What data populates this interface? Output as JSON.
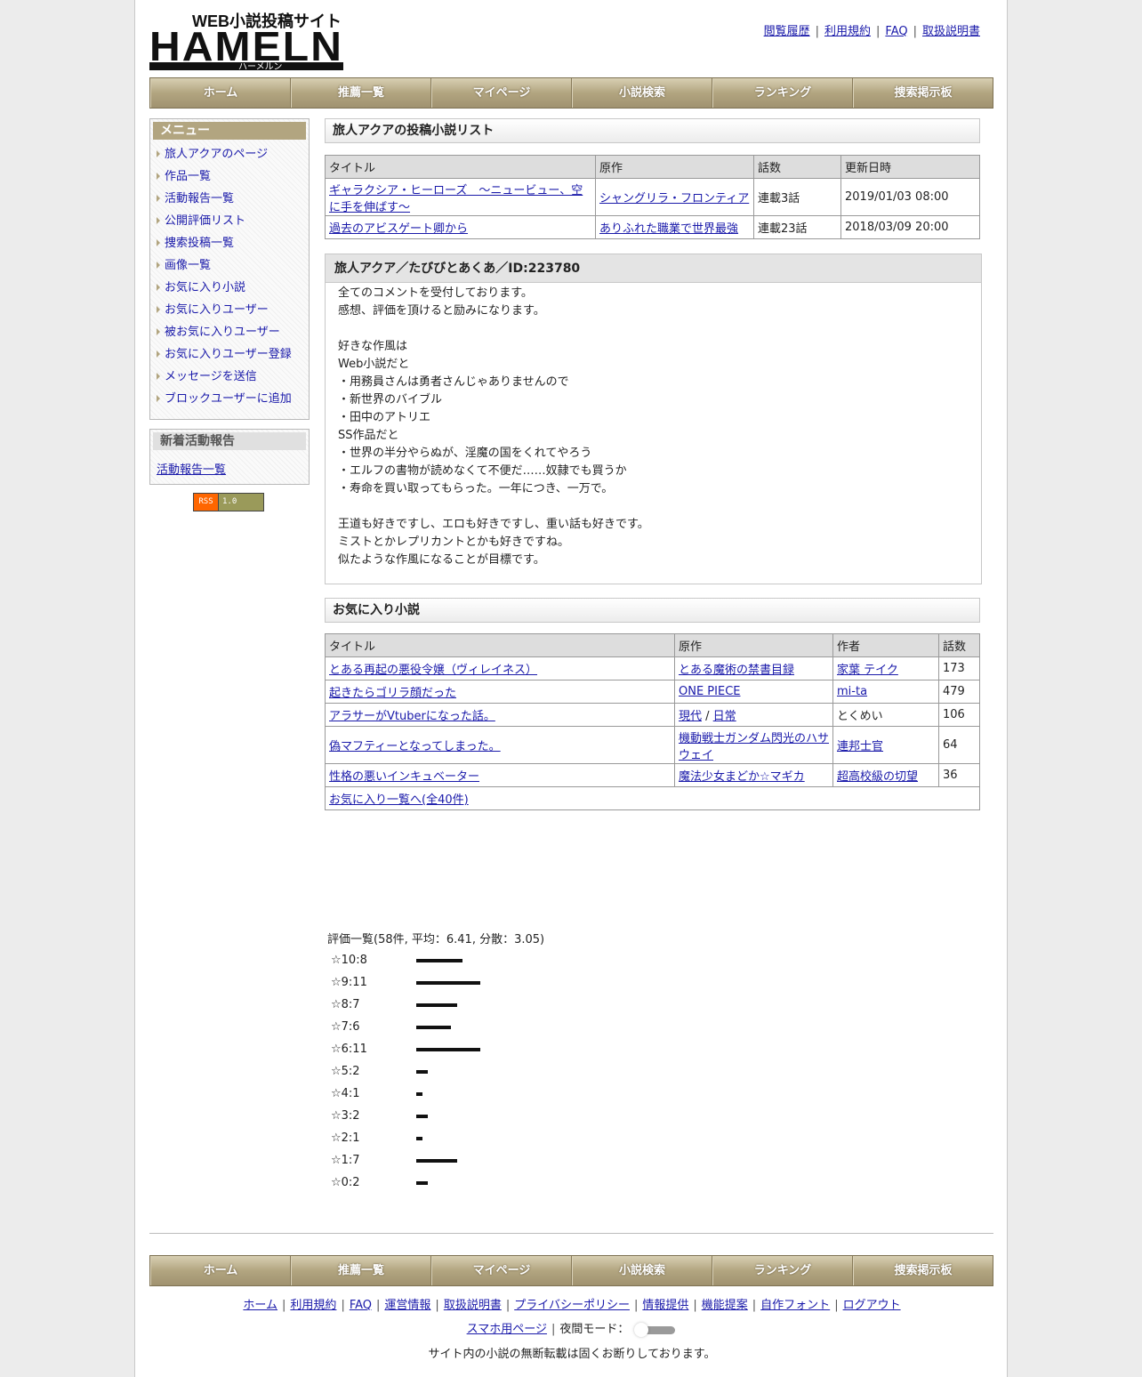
{
  "logo": {
    "top_text": "WEB小説投稿サイト",
    "main_text": "HAMELN",
    "kana": "ハーメルン"
  },
  "top_links": [
    "閲覧履歴",
    "利用規約",
    "FAQ",
    "取扱説明書"
  ],
  "nav": [
    "ホーム",
    "推薦一覧",
    "マイページ",
    "小説検索",
    "ランキング",
    "捜索掲示板"
  ],
  "sidebar": {
    "menu_title": "メニュー",
    "menu_items": [
      "旅人アクアのページ",
      "作品一覧",
      "活動報告一覧",
      "公開評価リスト",
      "捜索投稿一覧",
      "画像一覧",
      "お気に入り小説",
      "お気に入りユーザー",
      "被お気に入りユーザー",
      "お気に入りユーザー登録",
      "メッセージを送信",
      "ブロックユーザーに追加"
    ],
    "news_title": "新着活動報告",
    "news_link": "活動報告一覧",
    "rss_left": "RSS",
    "rss_right": "1.0"
  },
  "novels": {
    "title": "旅人アクアの投稿小説リスト",
    "headers": [
      "タイトル",
      "原作",
      "話数",
      "更新日時"
    ],
    "rows": [
      {
        "title": "ギャラクシア・ヒーローズ　〜ニュービュー、空に手を伸ばす〜",
        "original": "シャングリラ・フロンティア",
        "episodes": "連載3話",
        "updated": "2019/01/03 08:00"
      },
      {
        "title": "過去のアビスゲート卿から",
        "original": "ありふれた職業で世界最強",
        "episodes": "連載23話",
        "updated": "2018/03/09 20:00"
      }
    ]
  },
  "profile": {
    "heading": "旅人アクア／たびびとあくあ／ID:223780",
    "lines": [
      "全てのコメントを受付しております。",
      "感想、評価を頂けると励みになります。",
      "",
      "好きな作風は",
      "Web小説だと",
      "・用務員さんは勇者さんじゃありませんので",
      "・新世界のバイブル",
      "・田中のアトリエ",
      "SS作品だと",
      "・世界の半分やらぬが、淫魔の国をくれてやろう",
      "・エルフの書物が読めなくて不便だ……奴隷でも買うか",
      "・寿命を買い取ってもらった。一年につき、一万で。",
      "",
      "王道も好きですし、エロも好きですし、重い話も好きです。",
      "ミストとかレプリカントとかも好きですね。",
      "似たような作風になることが目標です。"
    ]
  },
  "favorites": {
    "title": "お気に入り小説",
    "headers": [
      "タイトル",
      "原作",
      "作者",
      "話数"
    ],
    "rows": [
      {
        "title": "とある再起の悪役令嬢（ヴィレイネス）",
        "original": "とある魔術の禁書目録",
        "original2": "",
        "author": "家葉 テイク",
        "author_link": true,
        "episodes": "173"
      },
      {
        "title": "起きたらゴリラ顔だった",
        "original": "ONE PIECE",
        "original2": "",
        "author": "mi-ta",
        "author_link": true,
        "episodes": "479"
      },
      {
        "title": "アラサーがVtuberになった話。",
        "original": "現代",
        "original2": "日常",
        "author": "とくめい",
        "author_link": false,
        "episodes": "106"
      },
      {
        "title": "偽マフティーとなってしまった。",
        "original": "機動戦士ガンダム閃光のハサウェイ",
        "original2": "",
        "author": "連邦士官",
        "author_link": true,
        "episodes": "64"
      },
      {
        "title": "性格の悪いインキュベーター",
        "original": "魔法少女まどか☆マギカ",
        "original2": "",
        "author": "超高校級の切望",
        "author_link": true,
        "episodes": "36"
      }
    ],
    "more_link": "お気に入り一覧へ(全40件)"
  },
  "ratings": {
    "summary": "評価一覧(58件, 平均：6.41, 分散：3.05)",
    "items": [
      {
        "label": "☆10:8",
        "count": 8
      },
      {
        "label": "☆9:11",
        "count": 11
      },
      {
        "label": "☆8:7",
        "count": 7
      },
      {
        "label": "☆7:6",
        "count": 6
      },
      {
        "label": "☆6:11",
        "count": 11
      },
      {
        "label": "☆5:2",
        "count": 2
      },
      {
        "label": "☆4:1",
        "count": 1
      },
      {
        "label": "☆3:2",
        "count": 2
      },
      {
        "label": "☆2:1",
        "count": 1
      },
      {
        "label": "☆1:7",
        "count": 7
      },
      {
        "label": "☆0:2",
        "count": 2
      }
    ]
  },
  "footer": {
    "links": [
      "ホーム",
      "利用規約",
      "FAQ",
      "運営情報",
      "取扱説明書",
      "プライバシーポリシー",
      "情報提供",
      "機能提案",
      "自作フォント",
      "ログアウト"
    ],
    "mobile_link": "スマホ用ページ",
    "night_mode_label": "夜間モード：",
    "notice": "サイト内の小説の無断転載は固くお断りしております。"
  }
}
